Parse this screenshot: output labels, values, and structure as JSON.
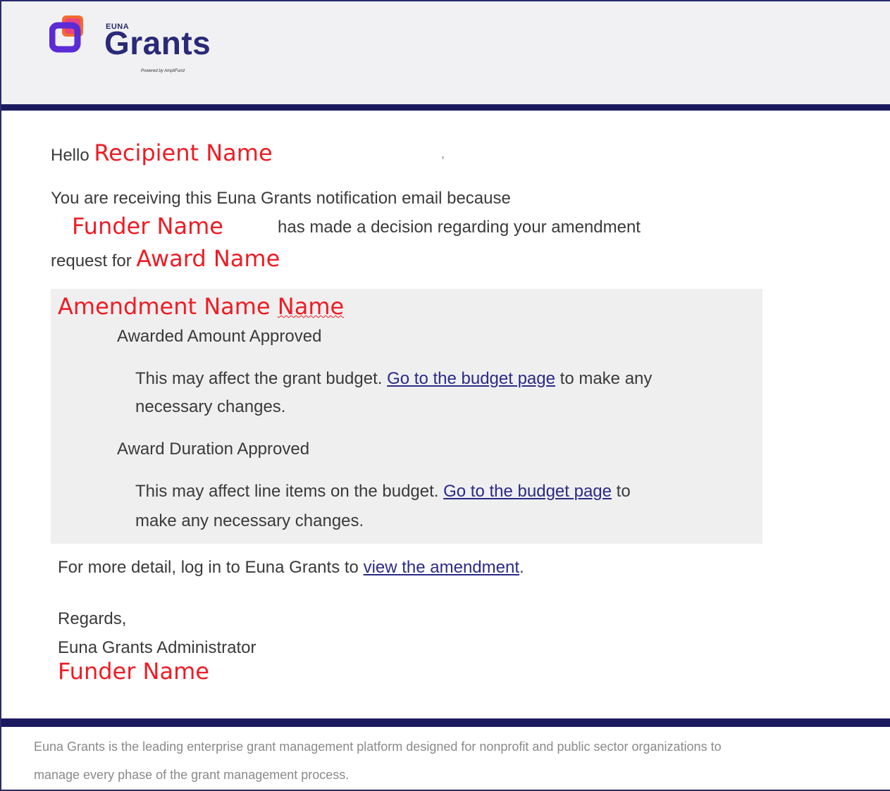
{
  "header": {
    "logo_small": "EUNA",
    "logo_main": "Grants",
    "logo_powered": "Powered by AmpliFund"
  },
  "email": {
    "greeting": "Hello",
    "recipient_placeholder": "Recipient Name",
    "greeting_comma": ",",
    "intro_line1": "You are receiving this Euna Grants notification email because",
    "funder_placeholder": "Funder Name",
    "intro_line2": "has made a decision regarding your amendment",
    "intro_line3_prefix": "request for",
    "award_placeholder": "Award Name",
    "amendment_placeholder": "Amendment Name",
    "amendment_placeholder_extra": "Name",
    "decisions": [
      {
        "title": "Awarded Amount Approved",
        "text_before": "This may affect the grant budget.",
        "link": "Go to the budget page",
        "text_after": "to make any",
        "text_line2": "necessary changes."
      },
      {
        "title": "Award Duration Approved",
        "text_before": "This may affect line items on the budget.",
        "link": "Go to the budget page",
        "text_after": "to",
        "text_line2": "make any necessary changes."
      }
    ],
    "detail_prefix": "For more detail, log in to Euna Grants to",
    "detail_link": "view the amendment",
    "detail_suffix": ".",
    "regards": "Regards,",
    "signature": "Euna Grants Administrator",
    "signature_funder_placeholder": "Funder Name"
  },
  "footer": {
    "line1": "Euna Grants is the leading enterprise grant management platform designed for nonprofit and public sector organizations to",
    "line2": "manage every phase of the grant management process."
  },
  "colors": {
    "brand_navy": "#1c1a5e",
    "placeholder_red": "#ee1c24",
    "link": "#2a2a88",
    "logo_orange": "#f26b2b",
    "logo_purple": "#5b2bd6",
    "logo_pink": "#e83e8c"
  }
}
